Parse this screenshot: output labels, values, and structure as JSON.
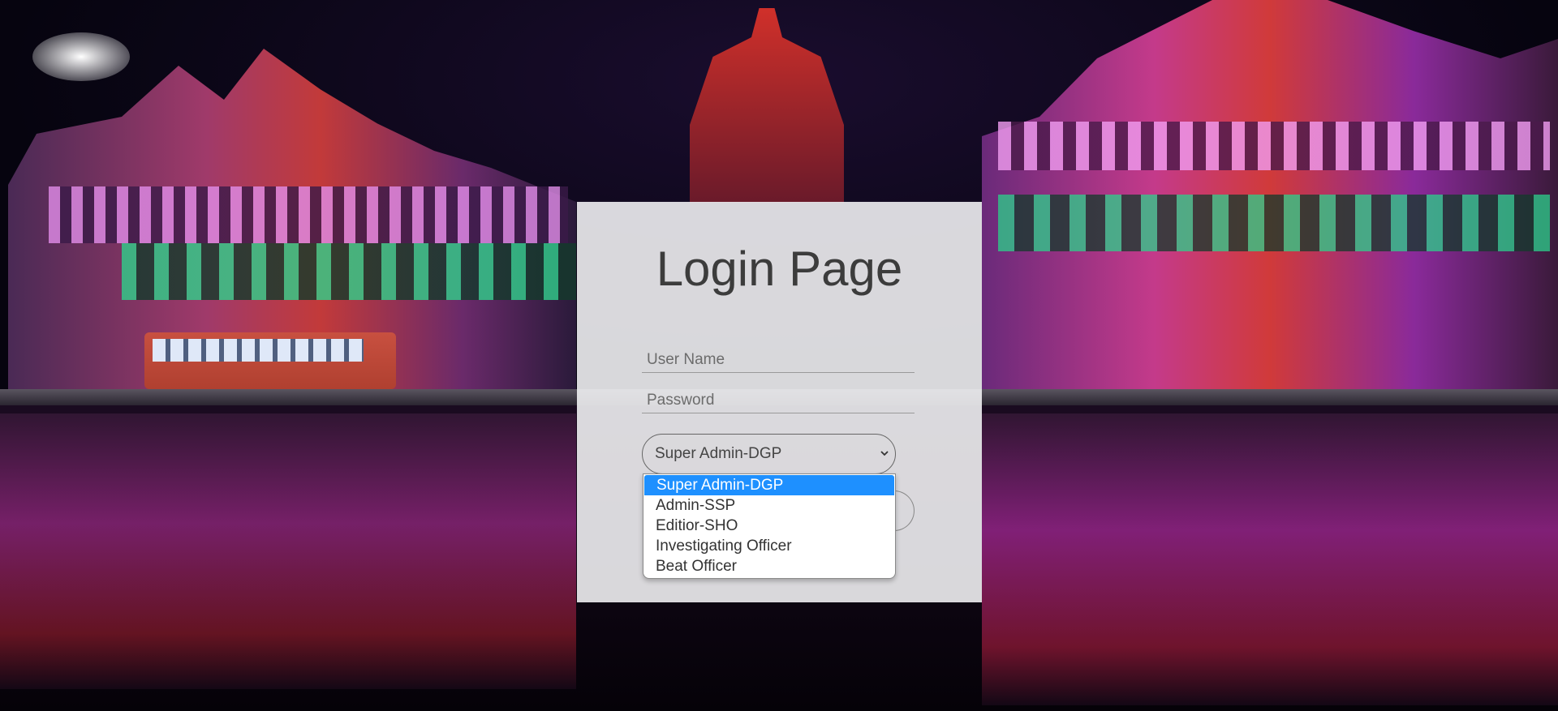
{
  "login": {
    "title": "Login Page",
    "username_placeholder": "User Name",
    "password_placeholder": "Password",
    "role_selected": "Super Admin-DGP"
  },
  "role_options": [
    "Super Admin-DGP",
    "Admin-SSP",
    "Editior-SHO",
    "Investigating Officer",
    "Beat Officer"
  ],
  "colors": {
    "accent": "#1e90ff",
    "card_background": "#f0f0f2",
    "title_text": "#3c3c3c"
  },
  "icons": {
    "select_arrow": "chevron-down-icon"
  }
}
